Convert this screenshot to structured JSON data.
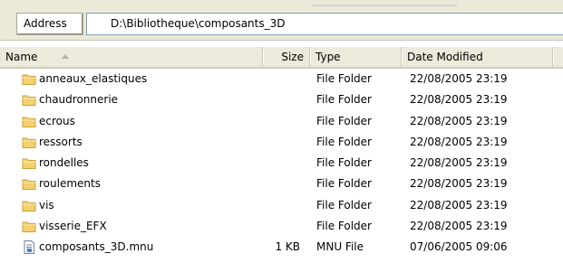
{
  "address": {
    "label": "Address",
    "path": "D:\\Bibliotheque\\composants_3D"
  },
  "columns": {
    "name": "Name",
    "size": "Size",
    "type": "Type",
    "date": "Date Modified"
  },
  "files": [
    {
      "name": "anneaux_elastiques",
      "size": "",
      "type": "File Folder",
      "date": "22/08/2005 23:19",
      "icon": "folder-icon"
    },
    {
      "name": "chaudronnerie",
      "size": "",
      "type": "File Folder",
      "date": "22/08/2005 23:19",
      "icon": "folder-icon"
    },
    {
      "name": "ecrous",
      "size": "",
      "type": "File Folder",
      "date": "22/08/2005 23:19",
      "icon": "folder-icon"
    },
    {
      "name": "ressorts",
      "size": "",
      "type": "File Folder",
      "date": "22/08/2005 23:19",
      "icon": "folder-icon"
    },
    {
      "name": "rondelles",
      "size": "",
      "type": "File Folder",
      "date": "22/08/2005 23:19",
      "icon": "folder-icon"
    },
    {
      "name": "roulements",
      "size": "",
      "type": "File Folder",
      "date": "22/08/2005 23:19",
      "icon": "folder-icon"
    },
    {
      "name": "vis",
      "size": "",
      "type": "File Folder",
      "date": "22/08/2005 23:19",
      "icon": "folder-icon"
    },
    {
      "name": "visserie_EFX",
      "size": "",
      "type": "File Folder",
      "date": "22/08/2005 23:19",
      "icon": "folder-icon"
    },
    {
      "name": "composants_3D.mnu",
      "size": "1 KB",
      "type": "MNU File",
      "date": "07/06/2005 09:06",
      "icon": "document-icon"
    }
  ],
  "colors": {
    "folder": "#f4d06f",
    "folder_outline": "#c9a23a",
    "header_bg": "#ebeadb",
    "toolbar_bg": "#ece9d8"
  }
}
